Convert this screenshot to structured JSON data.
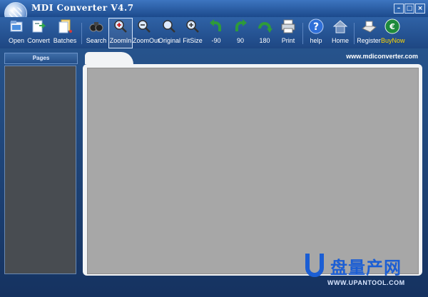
{
  "window": {
    "title": "MDI Converter V4.7",
    "min_symbol": "–",
    "max_symbol": "□",
    "close_symbol": "×"
  },
  "toolbar": {
    "open": "Open",
    "convert": "Convert",
    "batches": "Batches",
    "search": "Search",
    "zoomin": "ZoomIn",
    "zoomout": "ZoomOut",
    "original": "Original",
    "fitsize": "FitSize",
    "rot_m90": "-90",
    "rot_90": "90",
    "rot_180": "180",
    "print": "Print",
    "help": "help",
    "home": "Home",
    "register": "Register",
    "buynow": "BuyNow"
  },
  "pages_panel": {
    "title": "Pages"
  },
  "viewer": {
    "url": "www.mdiconverter.com"
  },
  "watermark": {
    "brand": "盘量产网",
    "url": "WWW.UPANTOOL.COM"
  },
  "colors": {
    "window_blue": "#1f4a86",
    "viewer_bg": "#a7a7a7",
    "pages_bg": "#484c51",
    "accent_yellow": "#ffd700"
  }
}
